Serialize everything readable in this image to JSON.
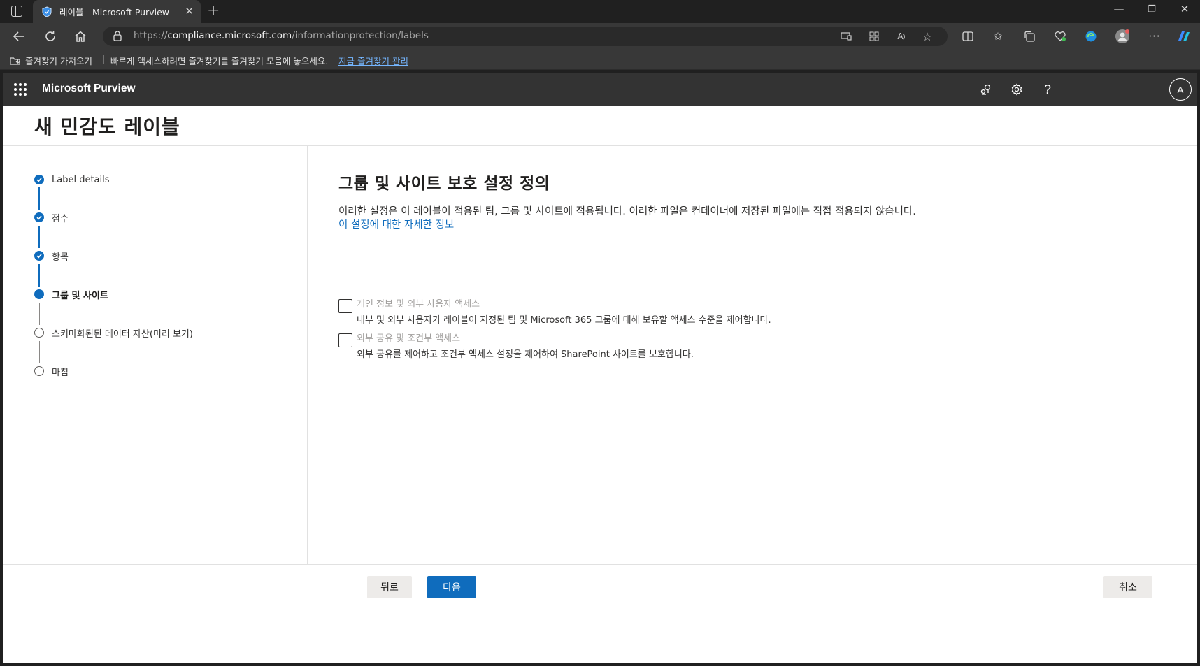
{
  "browser": {
    "tab_title": "레이블 - Microsoft Purview",
    "url_scheme": "https://",
    "url_host": "compliance.microsoft.com",
    "url_path": "/informationprotection/labels",
    "favorites_import": "즐겨찾기 가져오기",
    "favorites_message": "빠르게 액세스하려면 즐겨찾기를 즐겨찾기 모음에 놓으세요.",
    "favorites_manage_link": "지금 즐겨찾기 관리"
  },
  "app": {
    "name": "Microsoft Purview",
    "avatar_initial": "A"
  },
  "page": {
    "title": "새 민감도 레이블"
  },
  "steps": [
    {
      "label": "Label details",
      "state": "done"
    },
    {
      "label": "점수",
      "state": "done"
    },
    {
      "label": "항목",
      "state": "done"
    },
    {
      "label": "그룹 및 사이트",
      "state": "current"
    },
    {
      "label": "스키마화된된 데이터 자산(미리 보기)",
      "state": "todo"
    },
    {
      "label": "마침",
      "state": "todo"
    }
  ],
  "section": {
    "title": "그룹 및 사이트 보호 설정 정의",
    "description": "이러한 설정은 이 레이블이 적용된 팀, 그룹 및 사이트에 적용됩니다. 이러한 파일은 컨테이너에 저장된 파일에는 직접 적용되지 않습니다.",
    "learn_more": "이 설정에 대한 자세한 정보",
    "options": [
      {
        "label": "개인 정보 및 외부 사용자 액세스",
        "description": "내부 및 외부 사용자가 레이블이 지정된 팀 및 Microsoft 365 그룹에 대해 보유할 액세스 수준을 제어합니다.",
        "checked": false
      },
      {
        "label": "외부 공유 및 조건부 액세스",
        "description": "외부 공유를 제어하고 조건부 액세스 설정을 제어하여 SharePoint 사이트를 보호합니다.",
        "checked": false
      }
    ]
  },
  "footer": {
    "back_label": "뒤로",
    "next_label": "다음",
    "cancel_label": "취소"
  },
  "colors": {
    "accent": "#0f6cbd",
    "suite_bar": "#333333"
  }
}
